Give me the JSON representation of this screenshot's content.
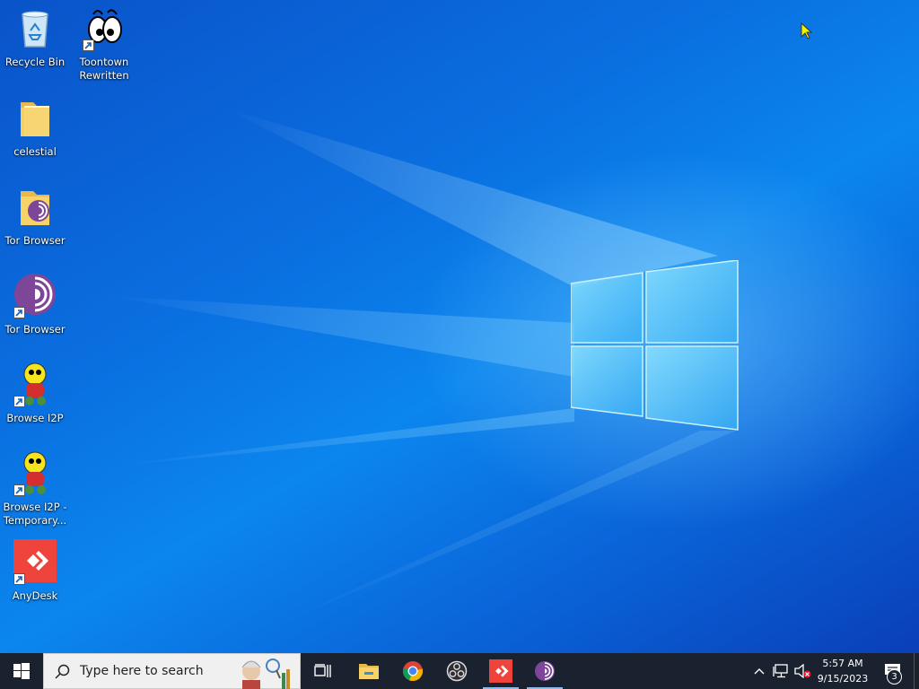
{
  "desktop": {
    "icons": [
      {
        "label": "Recycle Bin",
        "icon": "recycle-bin-icon"
      },
      {
        "label": "Toontown Rewritten",
        "icon": "toontown-icon"
      },
      {
        "label": "celestial",
        "icon": "folder-icon"
      },
      {
        "label": "Tor Browser",
        "icon": "tor-folder-icon"
      },
      {
        "label": "Tor Browser",
        "icon": "tor-browser-icon"
      },
      {
        "label": "Browse I2P",
        "icon": "i2p-icon"
      },
      {
        "label": "Browse I2P - Temporary...",
        "icon": "i2p-icon"
      },
      {
        "label": "AnyDesk",
        "icon": "anydesk-icon"
      }
    ]
  },
  "taskbar": {
    "start_icon": "windows-start-icon",
    "search_placeholder": "Type here to search",
    "pinned": [
      {
        "name": "task-view",
        "icon": "task-view-icon"
      },
      {
        "name": "file-explorer",
        "icon": "file-explorer-icon"
      },
      {
        "name": "chrome",
        "icon": "chrome-icon"
      },
      {
        "name": "obs",
        "icon": "obs-icon"
      },
      {
        "name": "anydesk",
        "icon": "anydesk-icon",
        "active": true
      },
      {
        "name": "tor-browser",
        "icon": "tor-browser-icon",
        "active": true
      }
    ],
    "tray": {
      "time": "5:57 AM",
      "date": "9/15/2023",
      "notification_count": "3"
    }
  },
  "colors": {
    "taskbar_bg": "#1a2230",
    "desktop_accent": "#0b86ee",
    "anydesk_red": "#ef443b",
    "tor_purple": "#7d4698"
  }
}
